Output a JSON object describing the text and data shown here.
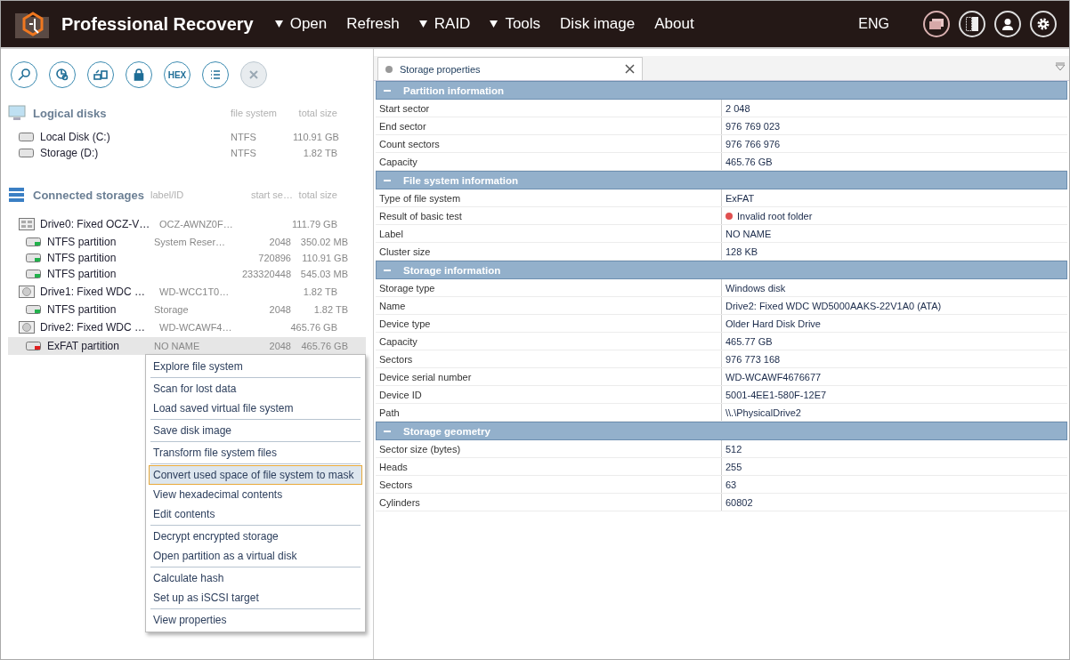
{
  "app": {
    "title": "Professional Recovery"
  },
  "menu": [
    {
      "label": "Open",
      "dropdown": true
    },
    {
      "label": "Refresh",
      "dropdown": false
    },
    {
      "label": "RAID",
      "dropdown": true
    },
    {
      "label": "Tools",
      "dropdown": true
    },
    {
      "label": "Disk image",
      "dropdown": false
    },
    {
      "label": "About",
      "dropdown": false
    }
  ],
  "language": "ENG",
  "toolbar": [
    {
      "kind": "search",
      "disabled": false
    },
    {
      "kind": "chart",
      "disabled": false
    },
    {
      "kind": "transfer",
      "disabled": false
    },
    {
      "kind": "lock",
      "disabled": false
    },
    {
      "kind": "text",
      "label": "HEX",
      "disabled": false
    },
    {
      "kind": "list",
      "disabled": false
    },
    {
      "kind": "close",
      "disabled": true
    }
  ],
  "logical_disks": {
    "title": "Logical disks",
    "columns": [
      "file system",
      "total size"
    ],
    "items": [
      {
        "name": "Local Disk (C:)",
        "file_system": "NTFS",
        "total_size": "110.91 GB"
      },
      {
        "name": "Storage (D:)",
        "file_system": "NTFS",
        "total_size": "1.82 TB"
      }
    ]
  },
  "connected_storages": {
    "title": "Connected storages",
    "columns": [
      "label/ID",
      "start se…",
      "total size"
    ],
    "items": [
      {
        "name": "Drive0: Fixed OCZ-V…",
        "kind": "ssd",
        "label": "OCZ-AWNZ0F…",
        "total_size": "111.79 GB",
        "children": [
          {
            "name": "NTFS partition",
            "label": "System Reser…",
            "start": "2048",
            "total_size": "350.02 MB",
            "color": "#22b14c",
            "selected": false
          },
          {
            "name": "NTFS partition",
            "start": "720896",
            "total_size": "110.91 GB",
            "color": "#22b14c",
            "selected": false
          },
          {
            "name": "NTFS partition",
            "start": "233320448",
            "total_size": "545.03 MB",
            "color": "#22b14c",
            "selected": false
          }
        ]
      },
      {
        "name": "Drive1: Fixed WDC …",
        "kind": "hdd",
        "label": "WD-WCC1T0…",
        "total_size": "1.82 TB",
        "children": [
          {
            "name": "NTFS partition",
            "label": "Storage",
            "start": "2048",
            "total_size": "1.82 TB",
            "color": "#22b14c",
            "selected": false
          }
        ]
      },
      {
        "name": "Drive2: Fixed WDC …",
        "kind": "hdd",
        "label": "WD-WCAWF4…",
        "total_size": "465.76 GB",
        "children": [
          {
            "name": "ExFAT partition",
            "label": "NO NAME",
            "start": "2048",
            "total_size": "465.76 GB",
            "color": "#e02020",
            "selected": true
          }
        ]
      }
    ]
  },
  "context_menu": {
    "groups": [
      [
        {
          "label": "Explore file system",
          "selected": false
        }
      ],
      [
        {
          "label": "Scan for lost data",
          "selected": false
        },
        {
          "label": "Load saved virtual file system",
          "selected": false
        }
      ],
      [
        {
          "label": "Save disk image",
          "selected": false
        }
      ],
      [
        {
          "label": "Transform file system files",
          "selected": false
        }
      ],
      [
        {
          "label": "Convert used space of file system to mask",
          "selected": true
        },
        {
          "label": "View hexadecimal contents",
          "selected": false
        },
        {
          "label": "Edit contents",
          "selected": false
        }
      ],
      [
        {
          "label": "Decrypt encrypted storage",
          "selected": false
        },
        {
          "label": "Open partition as a virtual disk",
          "selected": false
        }
      ],
      [
        {
          "label": "Calculate hash",
          "selected": false
        },
        {
          "label": "Set up as iSCSI target",
          "selected": false
        }
      ],
      [
        {
          "label": "View properties",
          "selected": false
        }
      ]
    ]
  },
  "tab": {
    "label": "Storage properties",
    "selected": true
  },
  "sections": [
    {
      "title": "Partition information",
      "expanded": true,
      "rows": [
        {
          "label": "Start sector",
          "value": "2 048"
        },
        {
          "label": "End sector",
          "value": "976 769 023"
        },
        {
          "label": "Count sectors",
          "value": "976 766 976"
        },
        {
          "label": "Capacity",
          "value": "465.76 GB"
        }
      ]
    },
    {
      "title": "File system information",
      "expanded": true,
      "rows": [
        {
          "label": "Type of file system",
          "value": "ExFAT"
        },
        {
          "label": "Result of basic test",
          "value": "Invalid root folder",
          "color": "#e05050"
        },
        {
          "label": "Label",
          "value": "NO NAME"
        },
        {
          "label": "Cluster size",
          "value": "128 KB"
        }
      ]
    },
    {
      "title": "Storage information",
      "expanded": true,
      "rows": [
        {
          "label": "Storage type",
          "value": "Windows disk"
        },
        {
          "label": "Name",
          "value": "Drive2: Fixed WDC WD5000AAKS-22V1A0 (ATA)"
        },
        {
          "label": "Device type",
          "value": "Older Hard Disk Drive"
        },
        {
          "label": "Capacity",
          "value": "465.77 GB"
        },
        {
          "label": "Sectors",
          "value": "976 773 168"
        },
        {
          "label": "Device serial number",
          "value": "WD-WCAWF4676677"
        },
        {
          "label": "Device ID",
          "value": "5001-4EE1-580F-12E7"
        },
        {
          "label": "Path",
          "value": "\\\\.\\PhysicalDrive2"
        }
      ]
    },
    {
      "title": "Storage geometry",
      "expanded": true,
      "rows": [
        {
          "label": "Sector size (bytes)",
          "value": "512"
        },
        {
          "label": "Heads",
          "value": "255"
        },
        {
          "label": "Sectors",
          "value": "63"
        },
        {
          "label": "Cylinders",
          "value": "60802"
        }
      ]
    }
  ]
}
